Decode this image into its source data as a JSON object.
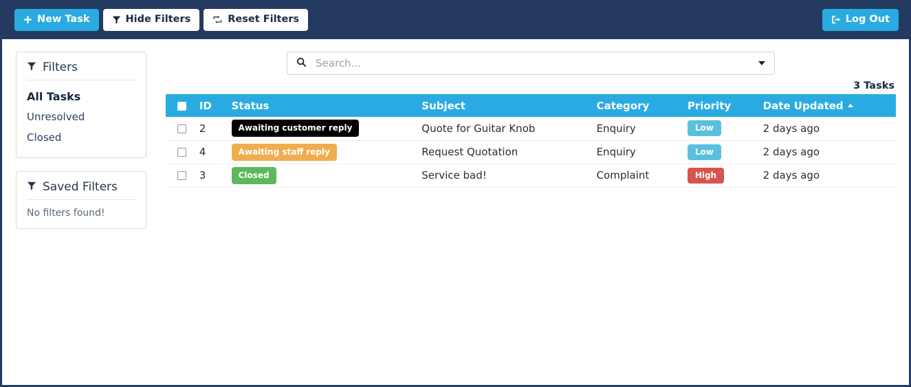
{
  "navbar": {
    "background": "#243a61",
    "buttons": [
      {
        "label": "New Task",
        "icon": "plus-icon",
        "style": "primary"
      },
      {
        "label": "Hide Filters",
        "icon": "funnel-icon",
        "style": "light"
      },
      {
        "label": "Reset Filters",
        "icon": "retweet-icon",
        "style": "light"
      }
    ],
    "logout": {
      "label": "Log Out",
      "icon": "sign-out-icon"
    }
  },
  "sidebar": {
    "filters_panel": {
      "title": "Filters",
      "icon": "funnel-icon",
      "items": [
        {
          "label": "All Tasks",
          "active": true
        },
        {
          "label": "Unresolved",
          "active": false
        },
        {
          "label": "Closed",
          "active": false
        }
      ]
    },
    "saved_filters_panel": {
      "title": "Saved Filters",
      "icon": "funnel-icon",
      "empty_text": "No filters found!"
    }
  },
  "search": {
    "icon": "search-icon",
    "placeholder": "Search...",
    "value": "",
    "dropdown_icon": "chevron-down-icon"
  },
  "task_count": "3 Tasks",
  "table": {
    "header_background": "#29abe2",
    "columns": [
      {
        "key": "check",
        "label": ""
      },
      {
        "key": "id",
        "label": "ID"
      },
      {
        "key": "status",
        "label": "Status"
      },
      {
        "key": "subject",
        "label": "Subject"
      },
      {
        "key": "category",
        "label": "Category"
      },
      {
        "key": "priority",
        "label": "Priority"
      },
      {
        "key": "date",
        "label": "Date Updated",
        "sort": "asc"
      }
    ],
    "rows": [
      {
        "id": "2",
        "status": {
          "label": "Awaiting customer reply",
          "color": "#000000"
        },
        "subject": "Quote for Guitar Knob",
        "category": "Enquiry",
        "priority": {
          "label": "Low",
          "color": "#5bc0de"
        },
        "date": "2 days ago"
      },
      {
        "id": "4",
        "status": {
          "label": "Awaiting staff reply",
          "color": "#f0ad4e"
        },
        "subject": "Request Quotation",
        "category": "Enquiry",
        "priority": {
          "label": "Low",
          "color": "#5bc0de"
        },
        "date": "2 days ago"
      },
      {
        "id": "3",
        "status": {
          "label": "Closed",
          "color": "#5cb85c"
        },
        "subject": "Service bad!",
        "category": "Complaint",
        "priority": {
          "label": "High",
          "color": "#d9534f"
        },
        "date": "2 days ago"
      }
    ]
  }
}
